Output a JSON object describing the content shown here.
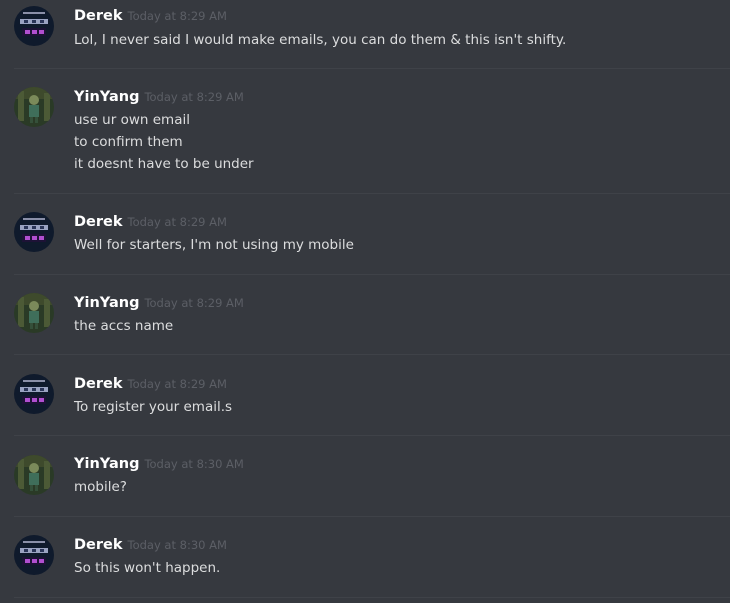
{
  "messages": [
    {
      "author": "Derek",
      "timestamp": "Today at 8:29 AM",
      "avatar_icon": "derek-avatar",
      "lines": [
        "Lol, I never said I would make emails, you can do them & this isn't shifty."
      ]
    },
    {
      "author": "YinYang",
      "timestamp": "Today at 8:29 AM",
      "avatar_icon": "yinyang-avatar",
      "lines": [
        "use ur own email",
        "to confirm them",
        "it doesnt have to be under"
      ]
    },
    {
      "author": "Derek",
      "timestamp": "Today at 8:29 AM",
      "avatar_icon": "derek-avatar",
      "lines": [
        "Well for starters, I'm not using my mobile"
      ]
    },
    {
      "author": "YinYang",
      "timestamp": "Today at 8:29 AM",
      "avatar_icon": "yinyang-avatar",
      "lines": [
        "the accs name"
      ]
    },
    {
      "author": "Derek",
      "timestamp": "Today at 8:29 AM",
      "avatar_icon": "derek-avatar",
      "lines": [
        "To register your email.s"
      ]
    },
    {
      "author": "YinYang",
      "timestamp": "Today at 8:30 AM",
      "avatar_icon": "yinyang-avatar",
      "lines": [
        "mobile?"
      ]
    },
    {
      "author": "Derek",
      "timestamp": "Today at 8:30 AM",
      "avatar_icon": "derek-avatar",
      "lines": [
        "So this won't happen."
      ]
    }
  ],
  "colors": {
    "background": "#36393f",
    "author": "#ffffff",
    "timestamp": "#5c5f66",
    "message_text": "#dcddde",
    "divider": "#3f4248"
  }
}
